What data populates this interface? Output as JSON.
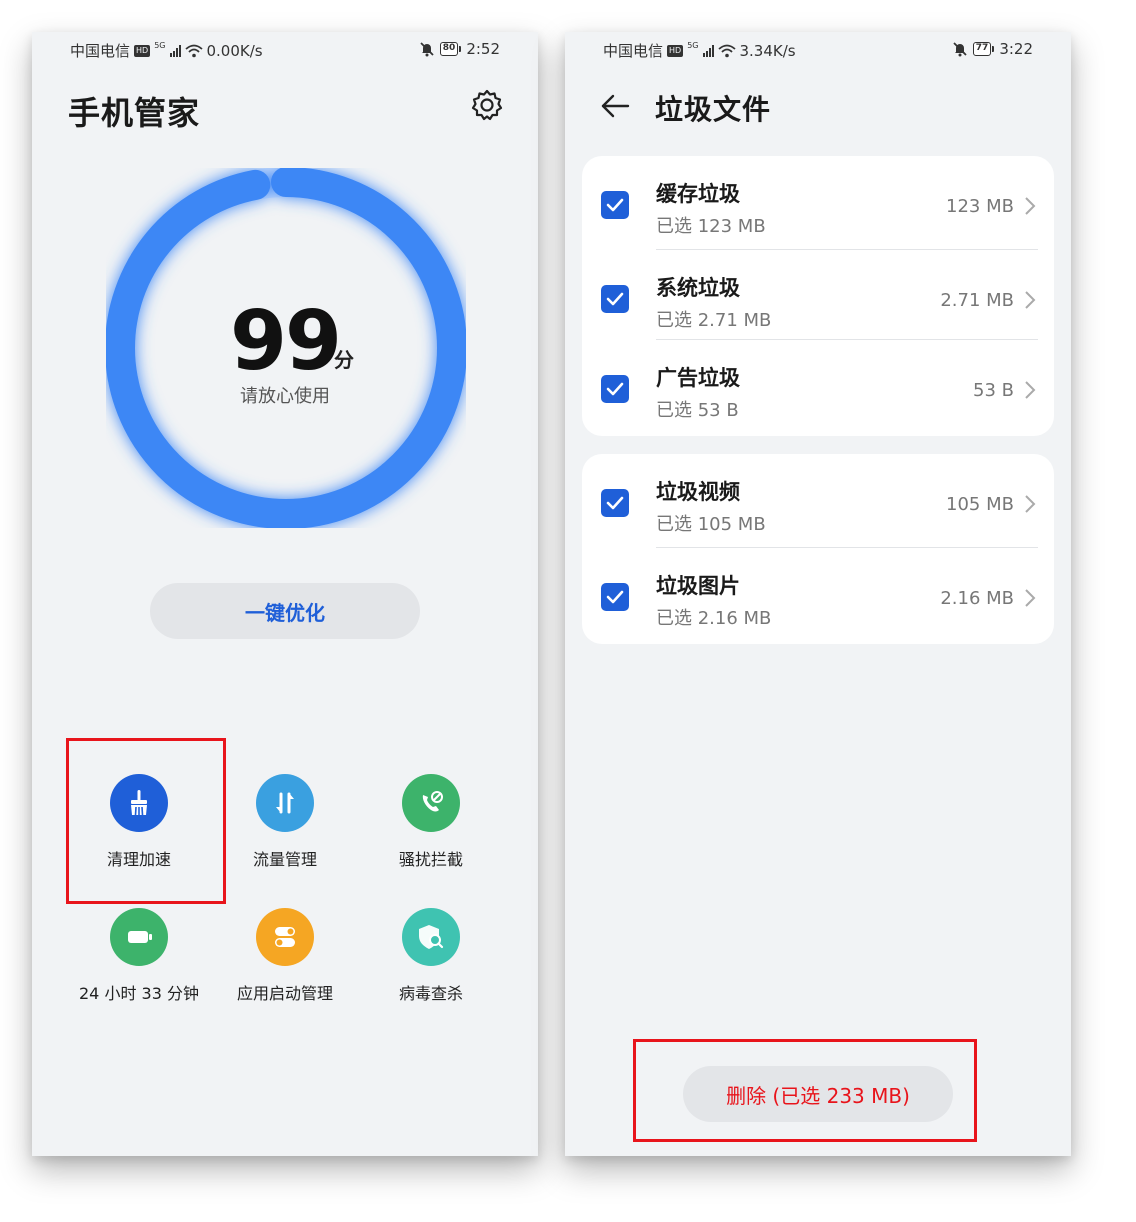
{
  "left": {
    "status": {
      "carrier": "中国电信",
      "hd": "HD",
      "net": "5G",
      "speed": "0.00K/s",
      "battery": "80",
      "time": "2:52"
    },
    "title": "手机管家",
    "score": {
      "value": "99",
      "unit": "分",
      "message": "请放心使用",
      "level": 0.97
    },
    "optimize_label": "一键优化",
    "tools": [
      {
        "label": "清理加速",
        "icon": "broom-icon",
        "color": "#1f5fd8"
      },
      {
        "label": "流量管理",
        "icon": "data-transfer-icon",
        "color": "#3aa0e0"
      },
      {
        "label": "骚扰拦截",
        "icon": "phone-block-icon",
        "color": "#3db36b"
      },
      {
        "label": "24 小时 33 分钟",
        "icon": "battery-icon",
        "color": "#3db36b"
      },
      {
        "label": "应用启动管理",
        "icon": "toggle-icon",
        "color": "#f5a623"
      },
      {
        "label": "病毒查杀",
        "icon": "shield-search-icon",
        "color": "#3fc3b1"
      }
    ],
    "colors": {
      "accent": "#1f5fd8",
      "ring": "#3d87f5",
      "highlight": "#e8141b"
    }
  },
  "right": {
    "status": {
      "carrier": "中国电信",
      "hd": "HD",
      "net": "5G",
      "speed": "3.34K/s",
      "battery": "77",
      "time": "3:22"
    },
    "title": "垃圾文件",
    "groups": [
      [
        {
          "title": "缓存垃圾",
          "sub": "已选 123 MB",
          "size": "123 MB"
        },
        {
          "title": "系统垃圾",
          "sub": "已选 2.71 MB",
          "size": "2.71 MB"
        },
        {
          "title": "广告垃圾",
          "sub": "已选 53 B",
          "size": "53 B"
        }
      ],
      [
        {
          "title": "垃圾视频",
          "sub": "已选 105 MB",
          "size": "105 MB"
        },
        {
          "title": "垃圾图片",
          "sub": "已选 2.16 MB",
          "size": "2.16 MB"
        }
      ]
    ],
    "delete_label": "删除 (已选 233 MB)"
  }
}
